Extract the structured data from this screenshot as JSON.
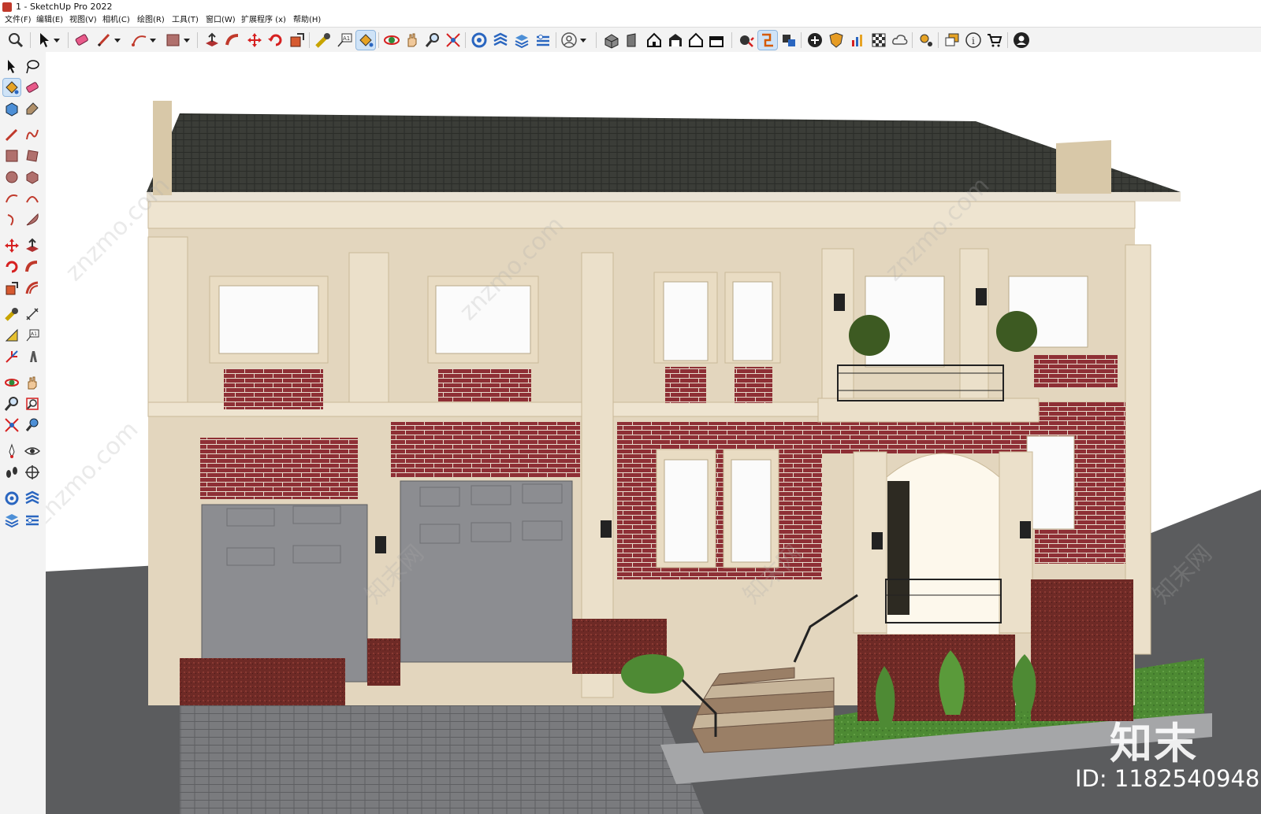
{
  "window": {
    "title": "1 - SketchUp Pro 2022"
  },
  "menu": [
    "文件(F)",
    "编辑(E)",
    "视图(V)",
    "相机(C)",
    "绘图(R)",
    "工具(T)",
    "窗口(W)",
    "扩展程序 (x)",
    "帮助(H)"
  ],
  "toolbar_icons": [
    "zoom-icon",
    "select-icon",
    "eraser-icon",
    "pencil-icon",
    "arc-icon",
    "rectangle-icon",
    "push-pull-icon",
    "follow-me-icon",
    "move-icon",
    "rotate-icon",
    "scale-icon",
    "tape-measure-icon",
    "text-icon",
    "paint-bucket-icon",
    "orbit-icon",
    "pan-icon",
    "zoom-tool-icon",
    "zoom-extents-icon",
    "warehouse-icon",
    "components-icon",
    "layers-icon",
    "styles-icon",
    "account-icon",
    "iso-view-icon",
    "front-view-icon",
    "home-view-icon",
    "top-view-icon",
    "right-view-icon",
    "back-view-icon",
    "section-plane-icon",
    "section-display-icon",
    "solid-tools-icon",
    "add-icon",
    "shield-icon",
    "chart-icon",
    "checker-icon",
    "cloud-icon",
    "gear-icon",
    "window-icon",
    "info-icon",
    "cart-icon",
    "user-icon"
  ],
  "left_toolbar_icons": [
    "select-icon",
    "lasso-icon",
    "paint-icon",
    "eraser-icon",
    "make-component-icon",
    "tag-icon",
    "line-icon",
    "freehand-icon",
    "rectangle-icon",
    "rotated-rect-icon",
    "circle-icon",
    "polygon-icon",
    "arc-icon",
    "arc2-icon",
    "pie-icon",
    "arc3-icon",
    "move-icon",
    "push-pull-icon",
    "rotate-icon",
    "follow-me-icon",
    "scale-icon",
    "offset-icon",
    "tape-icon",
    "dimension-icon",
    "protractor-icon",
    "text-icon",
    "axes-icon",
    "3d-text-icon",
    "orbit-icon",
    "pan-icon",
    "zoom-icon",
    "zoom-window-icon",
    "zoom-extents-icon",
    "previous-view-icon",
    "position-camera-icon",
    "look-around-icon",
    "walk-icon",
    "section-icon",
    "warehouse-icon",
    "ext-warehouse-icon",
    "layers-icon",
    "outliner-icon"
  ],
  "colors": {
    "accent": "#cfe3f7",
    "brick": "#8e2f35",
    "stone": "#e3d6be",
    "roof": "#3b3d38",
    "garage": "#8c8d91",
    "paving": "#66676a",
    "grass": "#5a8f3c"
  },
  "watermark": {
    "brand": "知末",
    "id": "ID: 1182540948",
    "diagonal_text": "znzmo.com",
    "site_name": "知末网"
  }
}
